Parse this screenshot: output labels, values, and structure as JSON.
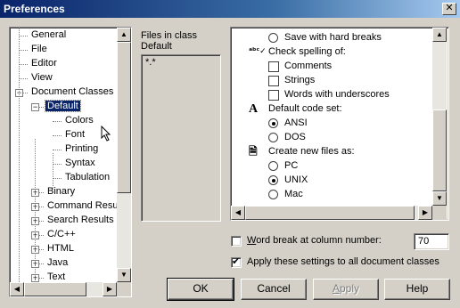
{
  "window": {
    "title": "Preferences",
    "close_glyph": "✕"
  },
  "tree": {
    "items": [
      {
        "label": "General"
      },
      {
        "label": "File"
      },
      {
        "label": "Editor"
      },
      {
        "label": "View"
      },
      {
        "label": "Document Classes",
        "expander": "−"
      },
      {
        "label": "Default",
        "expander": "−",
        "selected": true
      },
      {
        "label": "Colors"
      },
      {
        "label": "Font"
      },
      {
        "label": "Printing"
      },
      {
        "label": "Syntax"
      },
      {
        "label": "Tabulation"
      },
      {
        "label": "Binary",
        "expander": "+"
      },
      {
        "label": "Command Resu",
        "expander": "+"
      },
      {
        "label": "Search Results",
        "expander": "+"
      },
      {
        "label": "C/C++",
        "expander": "+"
      },
      {
        "label": "HTML",
        "expander": "+"
      },
      {
        "label": "Java",
        "expander": "+"
      },
      {
        "label": "Text",
        "expander": "+"
      }
    ]
  },
  "files": {
    "label_line1": "Files in class",
    "label_line2": "Default",
    "items": [
      "*.*"
    ]
  },
  "options": {
    "items": [
      {
        "type": "radio",
        "label": "Save with hard breaks",
        "checked": false
      },
      {
        "type": "header",
        "icon": "spellcheck-icon",
        "label": "Check spelling of:"
      },
      {
        "type": "checkbox",
        "label": "Comments",
        "checked": false
      },
      {
        "type": "checkbox",
        "label": "Strings",
        "checked": false
      },
      {
        "type": "checkbox",
        "label": "Words with underscores",
        "checked": false
      },
      {
        "type": "header",
        "icon": "font-icon",
        "label": "Default code set:"
      },
      {
        "type": "radio",
        "label": "ANSI",
        "checked": true
      },
      {
        "type": "radio",
        "label": "DOS",
        "checked": false
      },
      {
        "type": "header",
        "icon": "new-file-icon",
        "label": "Create new files as:"
      },
      {
        "type": "radio",
        "label": "PC",
        "checked": false
      },
      {
        "type": "radio",
        "label": "UNIX",
        "checked": true
      },
      {
        "type": "radio",
        "label": "Mac",
        "checked": false
      }
    ]
  },
  "word_break": {
    "label": "Word break at column number:",
    "underline_char": "W",
    "label_rest": "ord break at column number:",
    "checked": false,
    "value": "70"
  },
  "apply_all": {
    "label": "Apply these settings to all document classes",
    "checked": true
  },
  "buttons": {
    "ok": "OK",
    "cancel": "Cancel",
    "apply": "Apply",
    "help": "Help"
  }
}
